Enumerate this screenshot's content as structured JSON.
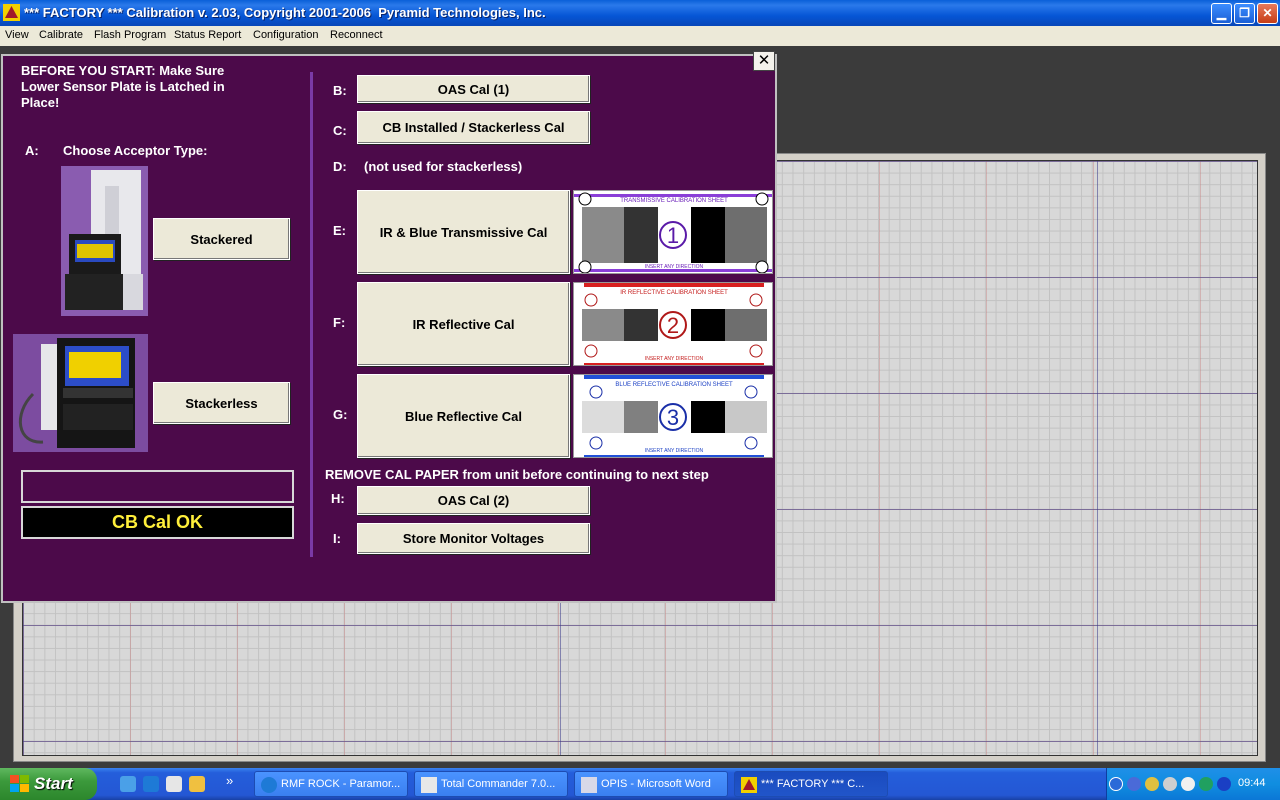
{
  "window": {
    "title": "*** FACTORY *** Calibration v. 2.03, Copyright 2001-2006  Pyramid Technologies, Inc.",
    "min_glyph": "▁",
    "max_glyph": "❐",
    "close_glyph": "✕"
  },
  "menu": [
    "View",
    "Calibrate",
    "Flash Program",
    "Status Report",
    "Configuration",
    "Reconnect"
  ],
  "dialog": {
    "close_glyph": "✕",
    "before_start": [
      "BEFORE YOU START:  Make Sure",
      "Lower Sensor Plate is Latched in",
      "Place!"
    ],
    "step_a_letter": "A:",
    "step_a_label": "Choose Acceptor Type:",
    "stackered_label": "Stackered",
    "stackerless_label": "Stackerless",
    "status_text": "",
    "cb_cal_status": "CB Cal OK",
    "steps": {
      "b": {
        "letter": "B:",
        "label": "OAS Cal (1)"
      },
      "c": {
        "letter": "C:",
        "label": "CB Installed / Stackerless Cal"
      },
      "d": {
        "letter": "D:",
        "label": "(not used for stackerless)"
      },
      "e": {
        "letter": "E:",
        "label": "IR & Blue Transmissive Cal"
      },
      "f": {
        "letter": "F:",
        "label": "IR Reflective Cal"
      },
      "g": {
        "letter": "G:",
        "label": "Blue Reflective Cal"
      },
      "h": {
        "letter": "H:",
        "label": "OAS Cal (2)"
      },
      "i": {
        "letter": "I:",
        "label": "Store Monitor Voltages"
      }
    },
    "remove_paper_note": "REMOVE CAL PAPER from unit before continuing to next step",
    "cal_sheets": {
      "e": {
        "num": "1",
        "header": "TRANSMISSIVE CALIBRATION SHEET",
        "footer": "INSERT ANY DIRECTION",
        "accent": "#6a1fb8"
      },
      "f": {
        "num": "2",
        "header": "IR REFLECTIVE CALIBRATION SHEET",
        "footer": "INSERT ANY DIRECTION",
        "accent": "#c41a1a"
      },
      "g": {
        "num": "3",
        "header": "BLUE REFLECTIVE CALIBRATION SHEET",
        "footer": "INSERT ANY DIRECTION",
        "accent": "#1a3fc4"
      }
    }
  },
  "taskbar": {
    "start_label": "Start",
    "tasks": [
      "RMF ROCK - Paramor...",
      "Total Commander 7.0...",
      "OPIS - Microsoft Word",
      "*** FACTORY *** C..."
    ],
    "overflow_glyph": "»",
    "clock": "09:44"
  }
}
